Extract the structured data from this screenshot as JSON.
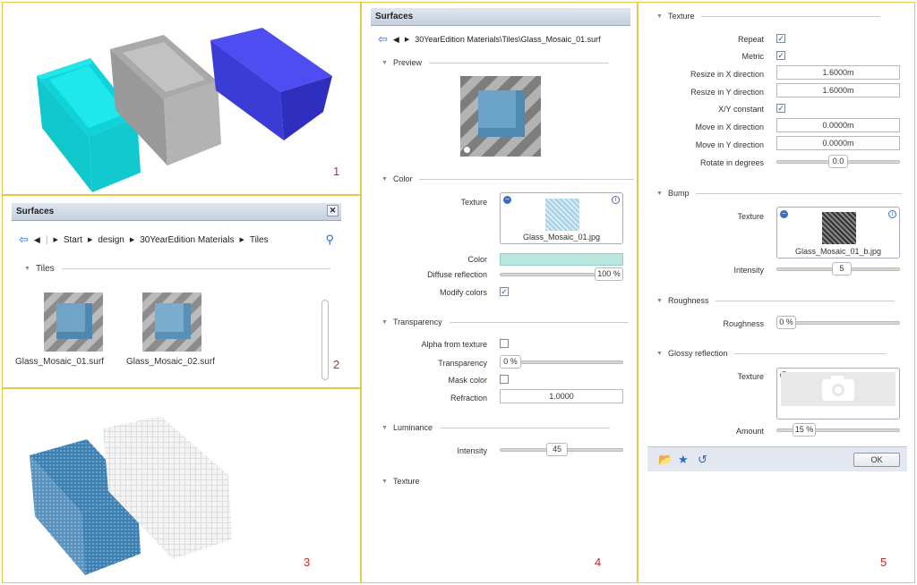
{
  "panel1": {
    "number": "1"
  },
  "panel2": {
    "number": "2",
    "window_title": "Surfaces",
    "breadcrumb": [
      "Start",
      "design",
      "30YearEdition Materials",
      "Tiles"
    ],
    "section": "Tiles",
    "items": [
      {
        "label": "Glass_Mosaic_01.surf"
      },
      {
        "label": "Glass_Mosaic_02.surf"
      }
    ]
  },
  "panel3": {
    "number": "3"
  },
  "panel4": {
    "number": "4",
    "window_title": "Surfaces",
    "path": "30YearEdition Materials\\Tiles\\Glass_Mosaic_01.surf",
    "preview_section": "Preview",
    "color_section": "Color",
    "texture_label": "Texture",
    "texture_file": "Glass_Mosaic_01.jpg",
    "color_label": "Color",
    "color_swatch": "#b9e6dd",
    "diffuse_label": "Diffuse reflection",
    "diffuse_value": "100 %",
    "modify_label": "Modify colors",
    "transparency_section": "Transparency",
    "alpha_label": "Alpha from texture",
    "transparency_label": "Transparency",
    "transparency_value": "0 %",
    "mask_label": "Mask color",
    "refraction_label": "Refraction",
    "refraction_value": "1.0000",
    "luminance_section": "Luminance",
    "intensity_label": "Intensity",
    "intensity_value": "45",
    "texture_section": "Texture"
  },
  "panel5": {
    "number": "5",
    "texture_section": "Texture",
    "repeat_label": "Repeat",
    "metric_label": "Metric",
    "resize_x_label": "Resize in X direction",
    "resize_x_value": "1.6000m",
    "resize_y_label": "Resize in Y direction",
    "resize_y_value": "1.6000m",
    "xy_label": "X/Y constant",
    "move_x_label": "Move in X direction",
    "move_x_value": "0.0000m",
    "move_y_label": "Move in Y direction",
    "move_y_value": "0.0000m",
    "rotate_label": "Rotate in degrees",
    "rotate_value": "0.0",
    "bump_section": "Bump",
    "bump_texture_label": "Texture",
    "bump_file": "Glass_Mosaic_01_b.jpg",
    "bump_intensity_label": "Intensity",
    "bump_intensity_value": "5",
    "roughness_section": "Roughness",
    "roughness_label": "Roughness",
    "roughness_value": "0 %",
    "glossy_section": "Glossy reflection",
    "glossy_texture_label": "Texture",
    "amount_label": "Amount",
    "amount_value": "15 %",
    "ok_label": "OK"
  }
}
